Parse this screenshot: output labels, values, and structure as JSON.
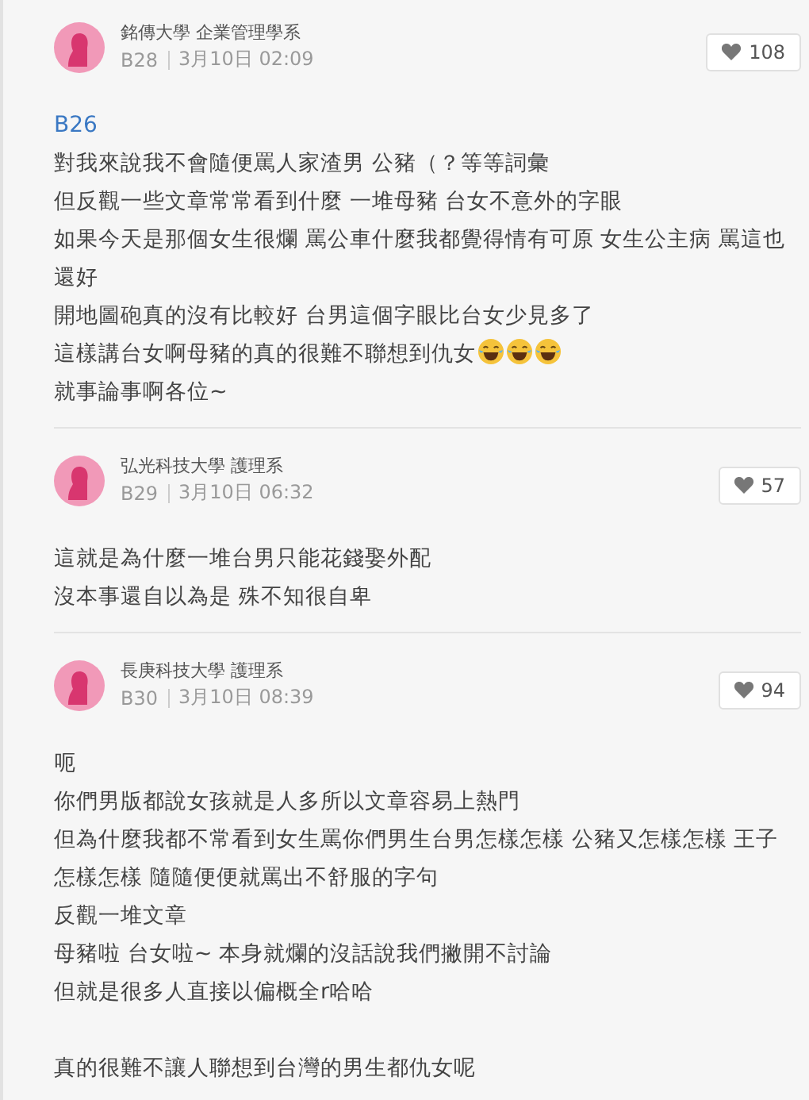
{
  "posts": [
    {
      "author": "銘傳大學 企業管理學系",
      "floor": "B28",
      "time": "3月10日 02:09",
      "likes": "108",
      "reply_to": "B26",
      "paragraphs": [
        [
          "對我來說我不會隨便罵人家渣男 公豬（？等等詞彙",
          "但反觀一些文章常常看到什麼 一堆母豬 台女不意外的字眼",
          "如果今天是那個女生很爛 罵公車什麼我都覺得情有可原 女生公主病 罵這也還好",
          "開地圖砲真的沒有比較好 台男這個字眼比台女少見多了",
          {
            "text": "這樣講台女啊母豬的真的很難不聯想到仇女",
            "icons": [
              {
                "kind": "laughing-face"
              },
              {
                "kind": "laughing-face"
              },
              {
                "kind": "laughing-face"
              }
            ]
          },
          "就事論事啊各位~"
        ]
      ]
    },
    {
      "author": "弘光科技大學 護理系",
      "floor": "B29",
      "time": "3月10日 06:32",
      "likes": "57",
      "paragraphs": [
        [
          "這就是為什麼一堆台男只能花錢娶外配",
          "沒本事還自以為是 殊不知很自卑"
        ]
      ]
    },
    {
      "author": "長庚科技大學 護理系",
      "floor": "B30",
      "time": "3月10日 08:39",
      "likes": "94",
      "paragraphs": [
        [
          "呃",
          "你們男版都說女孩就是人多所以文章容易上熱門",
          "但為什麼我都不常看到女生罵你們男生台男怎樣怎樣 公豬又怎樣怎樣 王子怎樣怎樣 隨隨便便就罵出不舒服的字句",
          "反觀一堆文章",
          "母豬啦 台女啦~ 本身就爛的沒話說我們撇開不討論",
          "但就是很多人直接以偏概全r哈哈"
        ],
        [
          "真的很難不讓人聯想到台灣的男生都仇女呢"
        ]
      ]
    }
  ]
}
